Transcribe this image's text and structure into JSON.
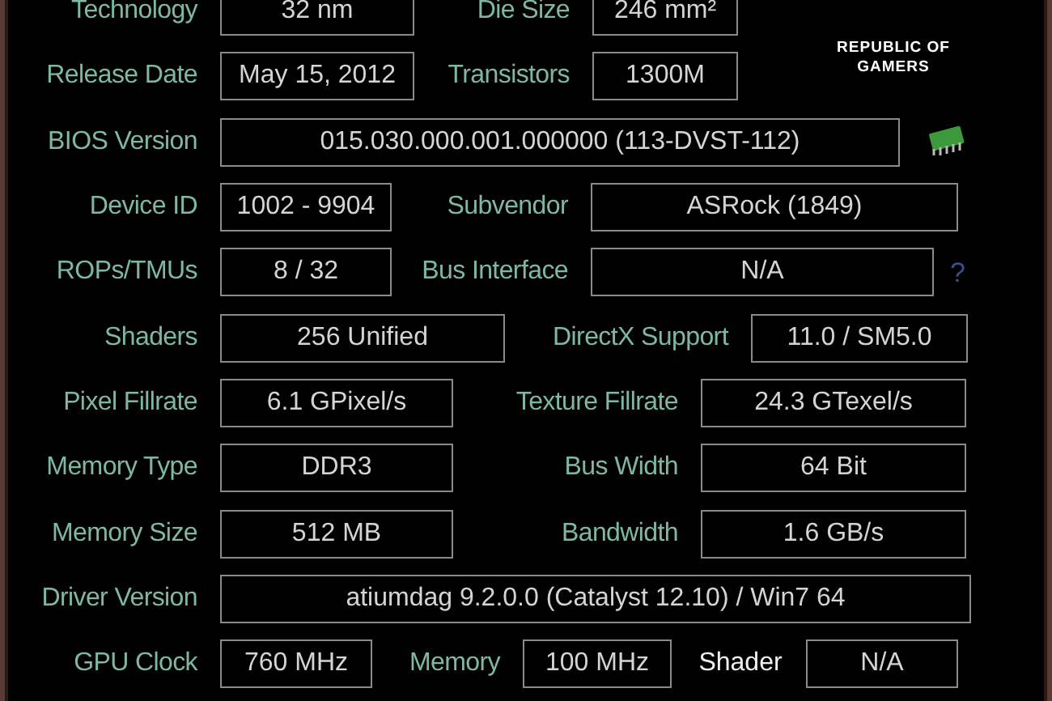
{
  "logo": {
    "lines": [
      "REPUBLIC OF",
      "GAMERS"
    ]
  },
  "rows": [
    {
      "cells": [
        {
          "kind": "label",
          "text": "Technology"
        },
        {
          "kind": "value",
          "text": "32 nm"
        },
        {
          "kind": "label",
          "text": "Die Size"
        },
        {
          "kind": "value",
          "text": "246 mm²"
        }
      ]
    },
    {
      "cells": [
        {
          "kind": "label",
          "text": "Release Date"
        },
        {
          "kind": "value",
          "text": "May 15, 2012"
        },
        {
          "kind": "label",
          "text": "Transistors"
        },
        {
          "kind": "value",
          "text": "1300M"
        }
      ]
    },
    {
      "cells": [
        {
          "kind": "label",
          "text": "BIOS Version"
        },
        {
          "kind": "value",
          "text": "015.030.000.001.000000 (113-DVST-112)"
        },
        {
          "kind": "chip"
        }
      ]
    },
    {
      "cells": [
        {
          "kind": "label",
          "text": "Device ID"
        },
        {
          "kind": "value",
          "text": "1002 - 9904"
        },
        {
          "kind": "label",
          "text": "Subvendor"
        },
        {
          "kind": "value",
          "text": "ASRock (1849)"
        }
      ]
    },
    {
      "cells": [
        {
          "kind": "label",
          "text": "ROPs/TMUs"
        },
        {
          "kind": "value",
          "text": "8 / 32"
        },
        {
          "kind": "label",
          "text": "Bus Interface"
        },
        {
          "kind": "value",
          "text": "N/A"
        },
        {
          "kind": "help",
          "text": "?"
        }
      ]
    },
    {
      "cells": [
        {
          "kind": "label",
          "text": "Shaders"
        },
        {
          "kind": "value",
          "text": "256 Unified"
        },
        {
          "kind": "label",
          "text": "DirectX Support"
        },
        {
          "kind": "value",
          "text": "11.0 / SM5.0"
        }
      ]
    },
    {
      "cells": [
        {
          "kind": "label",
          "text": "Pixel Fillrate"
        },
        {
          "kind": "value",
          "text": "6.1 GPixel/s"
        },
        {
          "kind": "label",
          "text": "Texture Fillrate"
        },
        {
          "kind": "value",
          "text": "24.3 GTexel/s"
        }
      ]
    },
    {
      "cells": [
        {
          "kind": "label",
          "text": "Memory Type"
        },
        {
          "kind": "value",
          "text": "DDR3"
        },
        {
          "kind": "label",
          "text": "Bus Width"
        },
        {
          "kind": "value",
          "text": "64 Bit"
        }
      ]
    },
    {
      "cells": [
        {
          "kind": "label",
          "text": "Memory Size"
        },
        {
          "kind": "value",
          "text": "512 MB"
        },
        {
          "kind": "label",
          "text": "Bandwidth"
        },
        {
          "kind": "value",
          "text": "1.6 GB/s"
        }
      ]
    },
    {
      "cells": [
        {
          "kind": "label",
          "text": "Driver Version"
        },
        {
          "kind": "value",
          "text": "atiumdag 9.2.0.0 (Catalyst 12.10) / Win7 64"
        }
      ]
    },
    {
      "cells": [
        {
          "kind": "label",
          "text": "GPU Clock"
        },
        {
          "kind": "value",
          "text": "760 MHz"
        },
        {
          "kind": "label",
          "text": "Memory"
        },
        {
          "kind": "value",
          "text": "100 MHz"
        },
        {
          "kind": "caption",
          "text": "Shader"
        },
        {
          "kind": "value",
          "text": "N/A"
        }
      ]
    }
  ]
}
